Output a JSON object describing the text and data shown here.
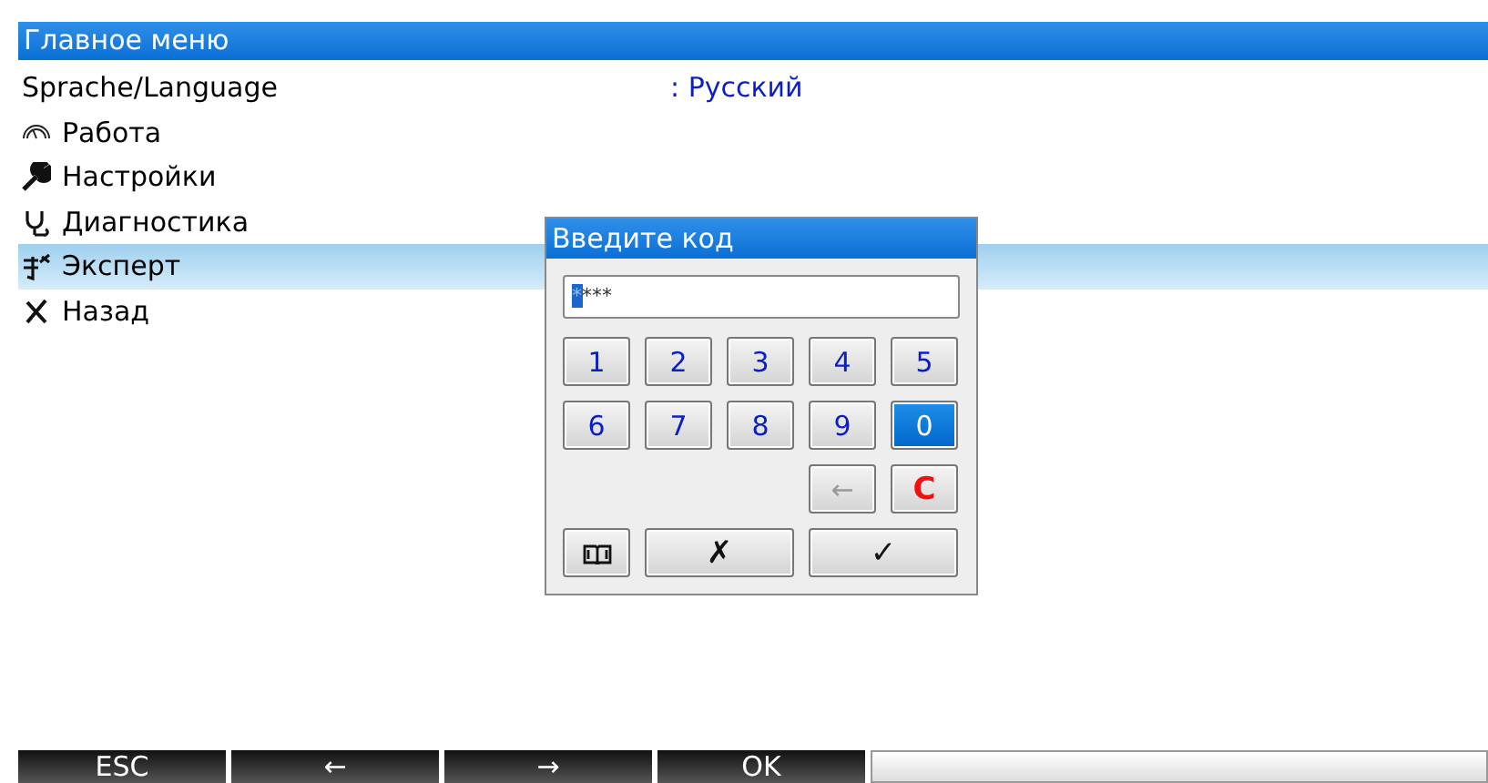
{
  "header": {
    "title": "Главное меню"
  },
  "menu": [
    {
      "label": "Sprache/Language",
      "kind": "setting",
      "value": ": Русский",
      "selected": false
    },
    {
      "label": "Работа",
      "kind": "operation",
      "selected": false
    },
    {
      "label": "Настройки",
      "kind": "setup",
      "selected": false
    },
    {
      "label": "Диагностика",
      "kind": "diagnostics",
      "selected": false
    },
    {
      "label": "Эксперт",
      "kind": "expert",
      "selected": true
    },
    {
      "label": "Назад",
      "kind": "back",
      "selected": false
    }
  ],
  "dialog": {
    "title": "Введите код",
    "field": {
      "value_selected": "*",
      "value_rest": "***"
    },
    "keys": [
      {
        "kind": "digit",
        "label": "1",
        "selected": false
      },
      {
        "kind": "digit",
        "label": "2",
        "selected": false
      },
      {
        "kind": "digit",
        "label": "3",
        "selected": false
      },
      {
        "kind": "digit",
        "label": "4",
        "selected": false
      },
      {
        "kind": "digit",
        "label": "5",
        "selected": false
      },
      {
        "kind": "digit",
        "label": "6",
        "selected": false
      },
      {
        "kind": "digit",
        "label": "7",
        "selected": false
      },
      {
        "kind": "digit",
        "label": "8",
        "selected": false
      },
      {
        "kind": "digit",
        "label": "9",
        "selected": false
      },
      {
        "kind": "digit",
        "label": "0",
        "selected": true
      },
      {
        "kind": "backspace",
        "label": "←",
        "selected": false
      },
      {
        "kind": "clear",
        "label": "C",
        "selected": false
      },
      {
        "kind": "book",
        "selected": false
      },
      {
        "kind": "cancel",
        "label": "✗",
        "selected": false
      },
      {
        "kind": "confirm",
        "label": "✓",
        "selected": false
      }
    ]
  },
  "softkeys": [
    "ESC",
    "←",
    "→",
    "OK"
  ]
}
